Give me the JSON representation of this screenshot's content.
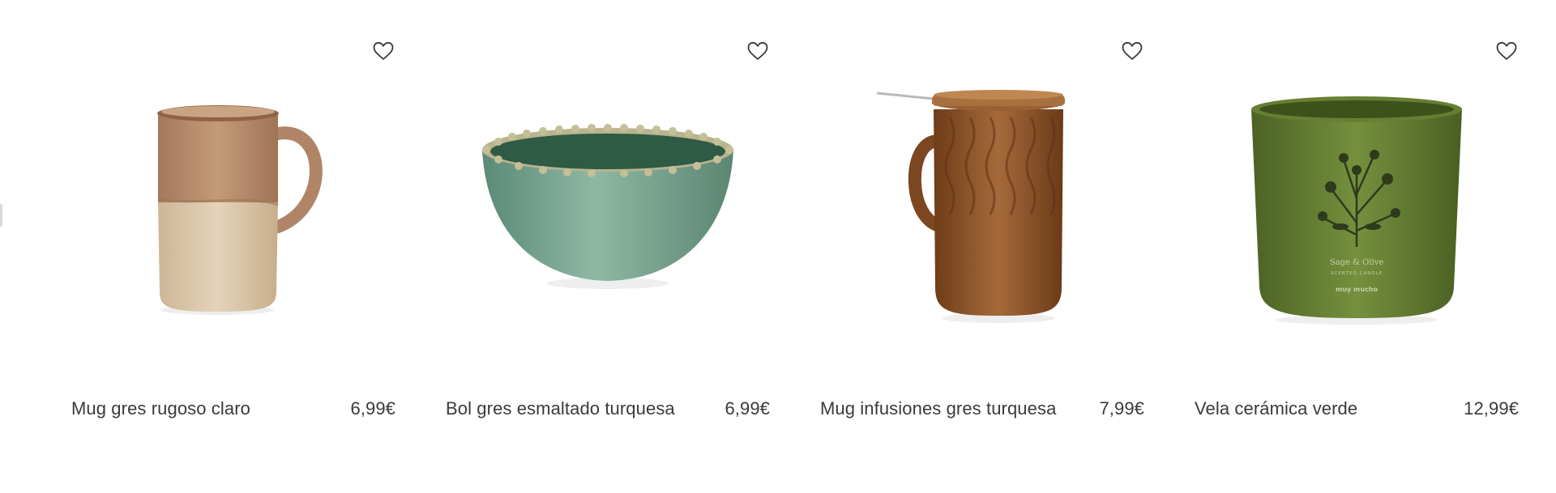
{
  "products": [
    {
      "name": "Mug gres rugoso claro",
      "price": "6,99€",
      "icon": "heart-icon"
    },
    {
      "name": "Bol gres esmaltado turquesa",
      "price": "6,99€",
      "icon": "heart-icon"
    },
    {
      "name": "Mug infusiones gres turquesa",
      "price": "7,99€",
      "icon": "heart-icon"
    },
    {
      "name": "Vela cerámica verde",
      "price": "12,99€",
      "icon": "heart-icon"
    }
  ],
  "candle_label": {
    "brand_line": "Sage & Olive",
    "sub_line": "SCENTED CANDLE",
    "maker": "muy mucho"
  },
  "colors": {
    "text": "#3a3a3a",
    "background": "#ffffff",
    "mug_top": "#b58d6c",
    "mug_bottom": "#dcc8ac",
    "bowl": "#6c9a86",
    "infuser_mug": "#8a4f22",
    "candle": "#5d7530"
  }
}
